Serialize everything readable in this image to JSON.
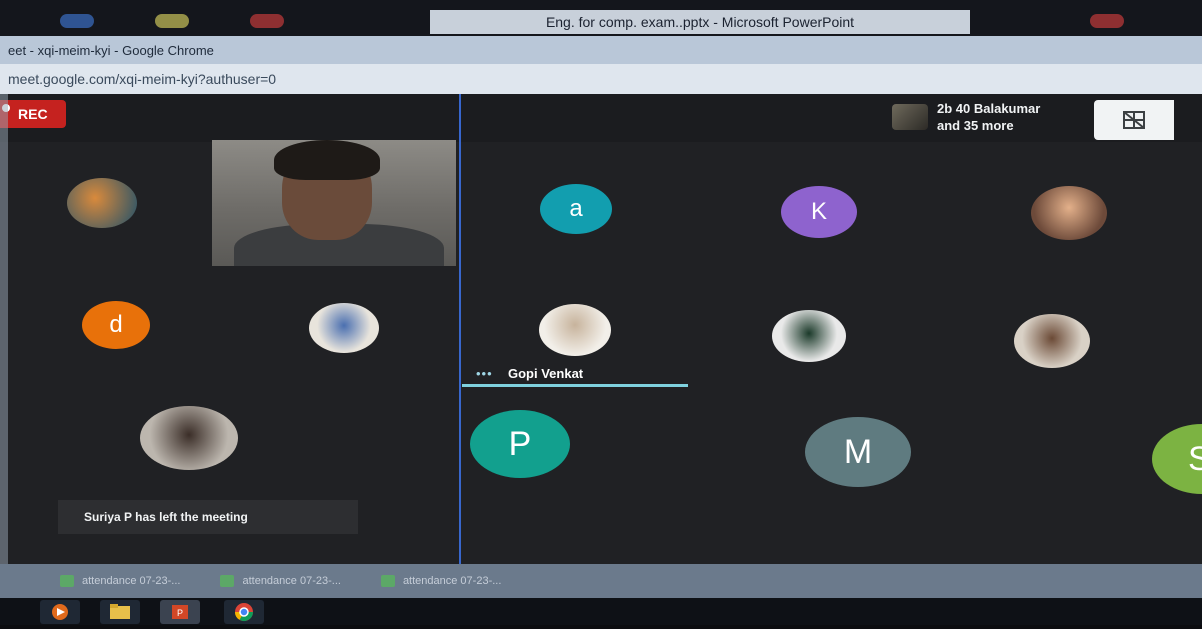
{
  "os": {
    "powerpoint_title": "Eng. for comp. exam..pptx - Microsoft PowerPoint"
  },
  "chrome": {
    "window_title": "eet - xqi-meim-kyi - Google Chrome",
    "url": "meet.google.com/xqi-meim-kyi?authuser=0"
  },
  "meet": {
    "rec_label": "REC",
    "participants_line1": "2b 40 Balakumar",
    "participants_line2": "and 35 more",
    "active_speaker": "Gopi Venkat",
    "toast": "Suriya P has left the meeting",
    "avatars": [
      {
        "name": "avatar-a",
        "letter": "a",
        "color": "#129eaf"
      },
      {
        "name": "avatar-k",
        "letter": "K",
        "color": "#8e63ce"
      },
      {
        "name": "avatar-d",
        "letter": "d",
        "color": "#e8710a"
      },
      {
        "name": "avatar-p",
        "letter": "P",
        "color": "#12a08e"
      },
      {
        "name": "avatar-m",
        "letter": "M",
        "color": "#5f7b80"
      },
      {
        "name": "avatar-s",
        "letter": "S",
        "color": "#7cb342"
      }
    ]
  },
  "taskbar": {
    "items": [
      "attendance 07-23-...",
      "attendance 07-23-...",
      "attendance 07-23-..."
    ]
  }
}
